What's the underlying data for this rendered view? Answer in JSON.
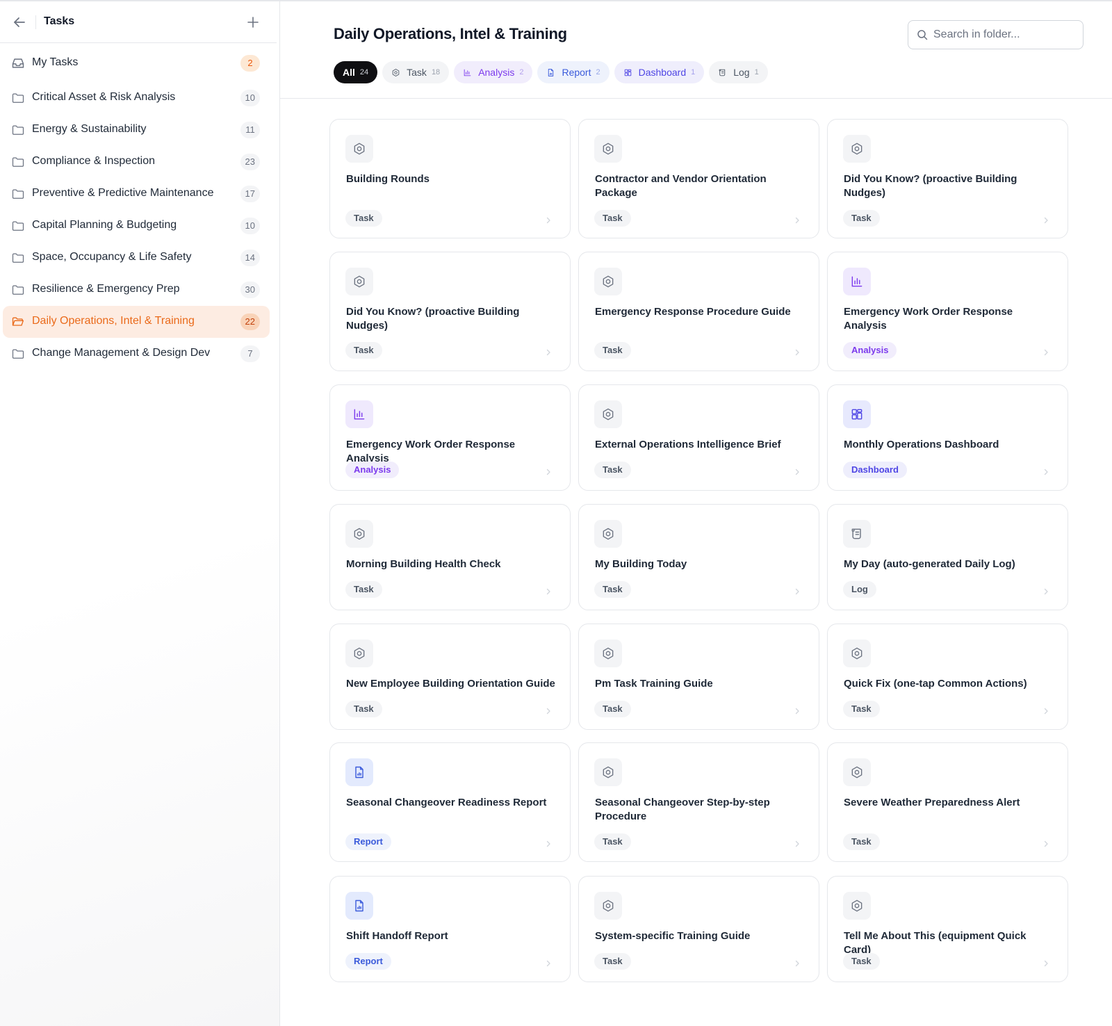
{
  "sidebar": {
    "title": "Tasks",
    "my_tasks": {
      "label": "My Tasks",
      "count": "2"
    },
    "folders": [
      {
        "label": "Critical Asset & Risk Analysis",
        "count": "10"
      },
      {
        "label": "Energy & Sustainability",
        "count": "11"
      },
      {
        "label": "Compliance & Inspection",
        "count": "23"
      },
      {
        "label": "Preventive & Predictive Maintenance",
        "count": "17"
      },
      {
        "label": "Capital Planning & Budgeting",
        "count": "10"
      },
      {
        "label": "Space, Occupancy & Life Safety",
        "count": "14"
      },
      {
        "label": "Resilience & Emergency Prep",
        "count": "30"
      },
      {
        "label": "Daily Operations, Intel & Training",
        "count": "22",
        "active": true
      },
      {
        "label": "Change Management & Design Dev",
        "count": "7"
      }
    ]
  },
  "header": {
    "title": "Daily Operations, Intel & Training",
    "search_placeholder": "Search in folder..."
  },
  "filters": [
    {
      "label": "All",
      "count": "24",
      "icon": "",
      "active": true
    },
    {
      "label": "Task",
      "count": "18",
      "icon": "task-icon"
    },
    {
      "label": "Analysis",
      "count": "2",
      "icon": "chart-icon"
    },
    {
      "label": "Report",
      "count": "2",
      "icon": "report-icon"
    },
    {
      "label": "Dashboard",
      "count": "1",
      "icon": "dashboard-icon"
    },
    {
      "label": "Log",
      "count": "1",
      "icon": "log-icon"
    }
  ],
  "cards": [
    {
      "title": "Building Rounds",
      "tag": "Task",
      "type": "task"
    },
    {
      "title": "Contractor and Vendor Orientation Package",
      "tag": "Task",
      "type": "task"
    },
    {
      "title": "Did You Know? (proactive Building Nudges)",
      "tag": "Task",
      "type": "task"
    },
    {
      "title": "Did You Know? (proactive Building Nudges)",
      "tag": "Task",
      "type": "task"
    },
    {
      "title": "Emergency Response Procedure Guide",
      "tag": "Task",
      "type": "task"
    },
    {
      "title": "Emergency Work Order Response Analysis",
      "tag": "Analysis",
      "type": "analysis"
    },
    {
      "title": "Emergency Work Order Response Analysis",
      "tag": "Analysis",
      "type": "analysis"
    },
    {
      "title": "External Operations Intelligence Brief",
      "tag": "Task",
      "type": "task"
    },
    {
      "title": "Monthly Operations Dashboard",
      "tag": "Dashboard",
      "type": "dashboard"
    },
    {
      "title": "Morning Building Health Check",
      "tag": "Task",
      "type": "task"
    },
    {
      "title": "My Building Today",
      "tag": "Task",
      "type": "task"
    },
    {
      "title": "My Day (auto-generated Daily Log)",
      "tag": "Log",
      "type": "log"
    },
    {
      "title": "New Employee Building Orientation Guide",
      "tag": "Task",
      "type": "task"
    },
    {
      "title": "Pm Task Training Guide",
      "tag": "Task",
      "type": "task"
    },
    {
      "title": "Quick Fix (one-tap Common Actions)",
      "tag": "Task",
      "type": "task"
    },
    {
      "title": "Seasonal Changeover Readiness Report",
      "tag": "Report",
      "type": "report"
    },
    {
      "title": "Seasonal Changeover Step-by-step Procedure",
      "tag": "Task",
      "type": "task"
    },
    {
      "title": "Severe Weather Preparedness Alert",
      "tag": "Task",
      "type": "task"
    },
    {
      "title": "Shift Handoff Report",
      "tag": "Report",
      "type": "report"
    },
    {
      "title": "System-specific Training Guide",
      "tag": "Task",
      "type": "task"
    },
    {
      "title": "Tell Me About This (equipment Quick Card)",
      "tag": "Task",
      "type": "task"
    }
  ]
}
